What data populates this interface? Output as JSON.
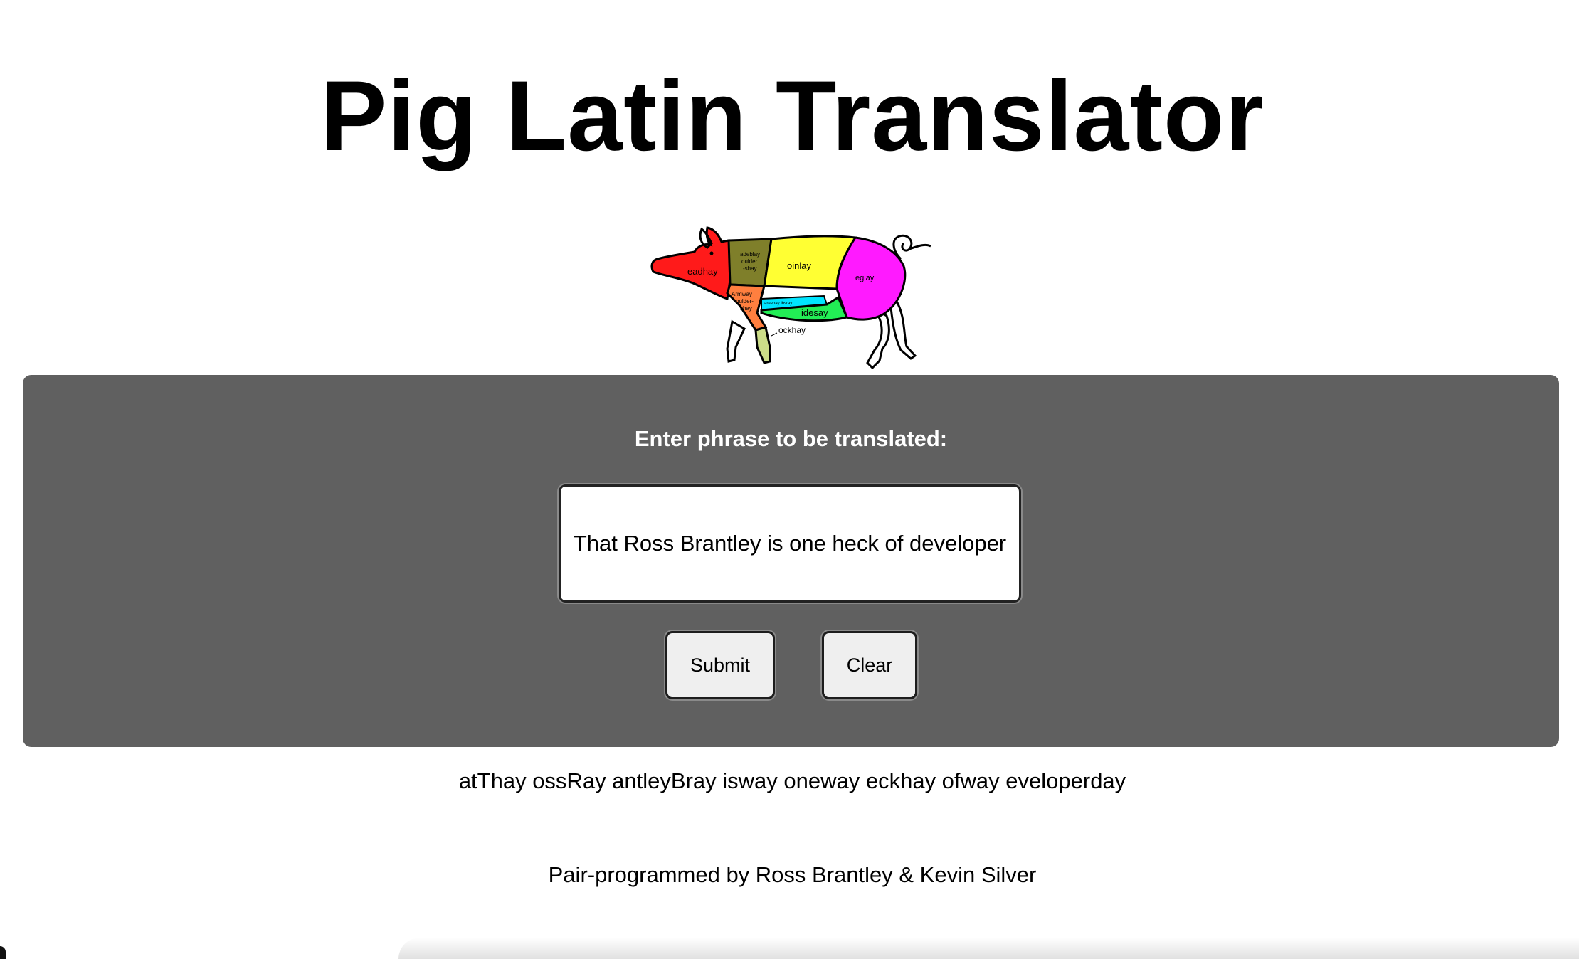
{
  "header": {
    "title": "Pig Latin Translator"
  },
  "pig_image": {
    "labels": {
      "head": "eadhay",
      "shoulder_blade_line1": "adeblay",
      "shoulder_blade_line2": "oulder",
      "shoulder_blade_line3": "-shay",
      "loin": "oinlay",
      "leg": "egiay",
      "arm_line1": "Armway",
      "arm_line2": "oulder-",
      "arm_line3": "shay",
      "spare_ribs": "areepay ibsray",
      "side": "idesay",
      "hock": "ockhay"
    },
    "colors": {
      "head": "#ff1a1a",
      "shoulder_blade": "#7f7f2a",
      "loin": "#ffff33",
      "leg": "#ff1aff",
      "arm": "#ff7f3f",
      "spare_ribs": "#00e5ff",
      "side": "#22ee55",
      "hock": "#ccdd88"
    }
  },
  "form": {
    "prompt": "Enter phrase to be translated:",
    "input_value": "That Ross Brantley is one heck of developer",
    "submit_label": "Submit",
    "clear_label": "Clear"
  },
  "result": {
    "text": "atThay ossRay antleyBray isway oneway eckhay ofway eveloperday"
  },
  "footer": {
    "credits": "Pair-programmed by Ross Brantley & Kevin Silver"
  }
}
